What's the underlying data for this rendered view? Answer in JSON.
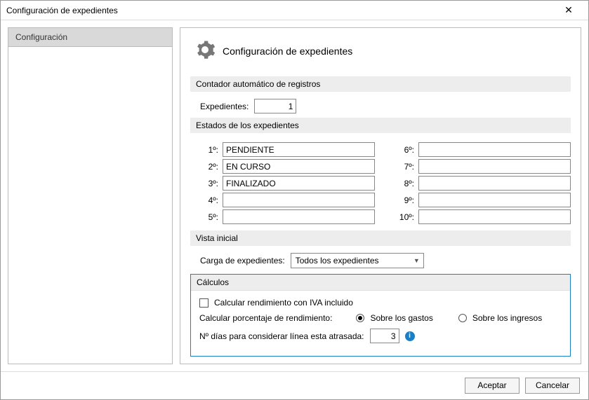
{
  "window": {
    "title": "Configuración de expedientes"
  },
  "sidebar": {
    "items": [
      {
        "label": "Configuración"
      }
    ]
  },
  "header": {
    "title": "Configuración de expedientes"
  },
  "sections": {
    "counter": {
      "title": "Contador automático de registros",
      "field_label": "Expedientes:",
      "value": "1"
    },
    "states": {
      "title": "Estados de los expedientes",
      "labels": [
        "1º:",
        "2º:",
        "3º:",
        "4º:",
        "5º:",
        "6º:",
        "7º:",
        "8º:",
        "9º:",
        "10º:"
      ],
      "values": [
        "PENDIENTE",
        "EN CURSO",
        "FINALIZADO",
        "",
        "",
        "",
        "",
        "",
        "",
        ""
      ]
    },
    "view": {
      "title": "Vista inicial",
      "field_label": "Carga de expedientes:",
      "selected": "Todos los expedientes"
    },
    "calc": {
      "title": "Cálculos",
      "iva_label": "Calcular rendimiento con IVA incluido",
      "iva_checked": false,
      "pct_label": "Calcular porcentaje de rendimiento:",
      "opt_gastos": "Sobre los gastos",
      "opt_ingresos": "Sobre los ingresos",
      "pct_selected": "gastos",
      "days_label": "Nº días para considerar línea esta atrasada:",
      "days_value": "3"
    }
  },
  "footer": {
    "ok": "Aceptar",
    "cancel": "Cancelar"
  }
}
